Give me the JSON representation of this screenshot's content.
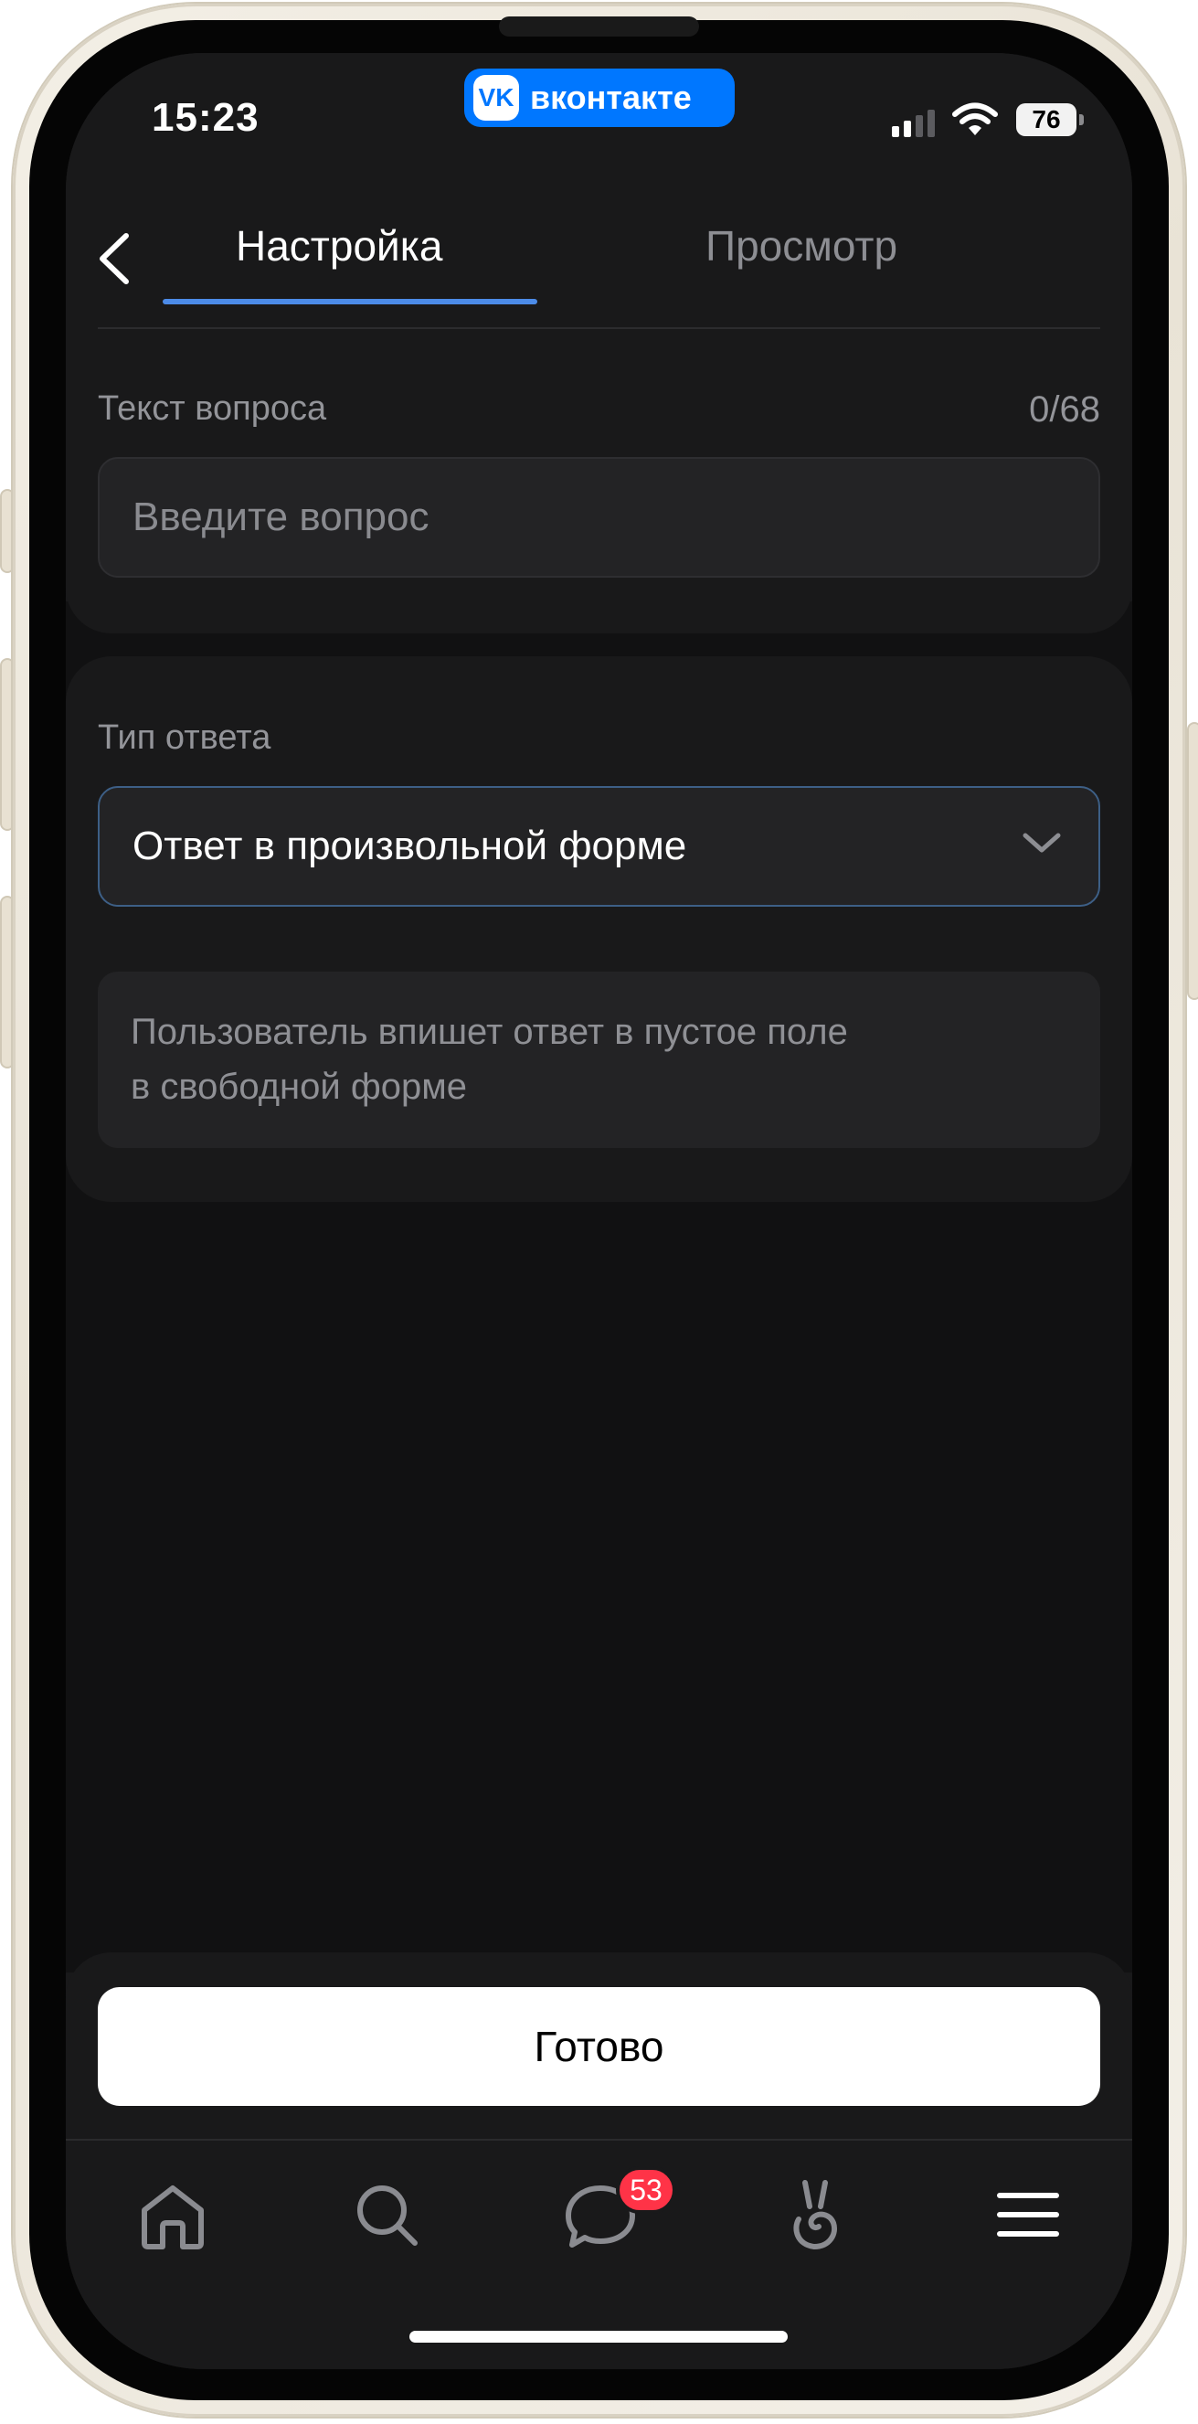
{
  "status_bar": {
    "time": "15:23",
    "app_badge": "вконтакте",
    "battery": "76"
  },
  "header": {
    "tabs": [
      {
        "label": "Настройка",
        "active": true
      },
      {
        "label": "Просмотр",
        "active": false
      }
    ]
  },
  "question": {
    "label": "Текст вопроса",
    "counter": "0/68",
    "placeholder": "Введите вопрос"
  },
  "answer_type": {
    "label": "Тип ответа",
    "selected": "Ответ в произвольной форме",
    "description_lines": [
      "Пользователь впишет ответ в пустое поле",
      "в свободной форме"
    ]
  },
  "done_button": "Готово",
  "nav": {
    "messages_badge": "53",
    "items": [
      "home-icon",
      "search-icon",
      "messages-icon",
      "clips-icon",
      "menu-icon"
    ]
  },
  "colors": {
    "accent": "#0077ff",
    "tab_underline": "#4c8be8",
    "badge": "#ff3347",
    "screen_bg": "#19191a"
  }
}
